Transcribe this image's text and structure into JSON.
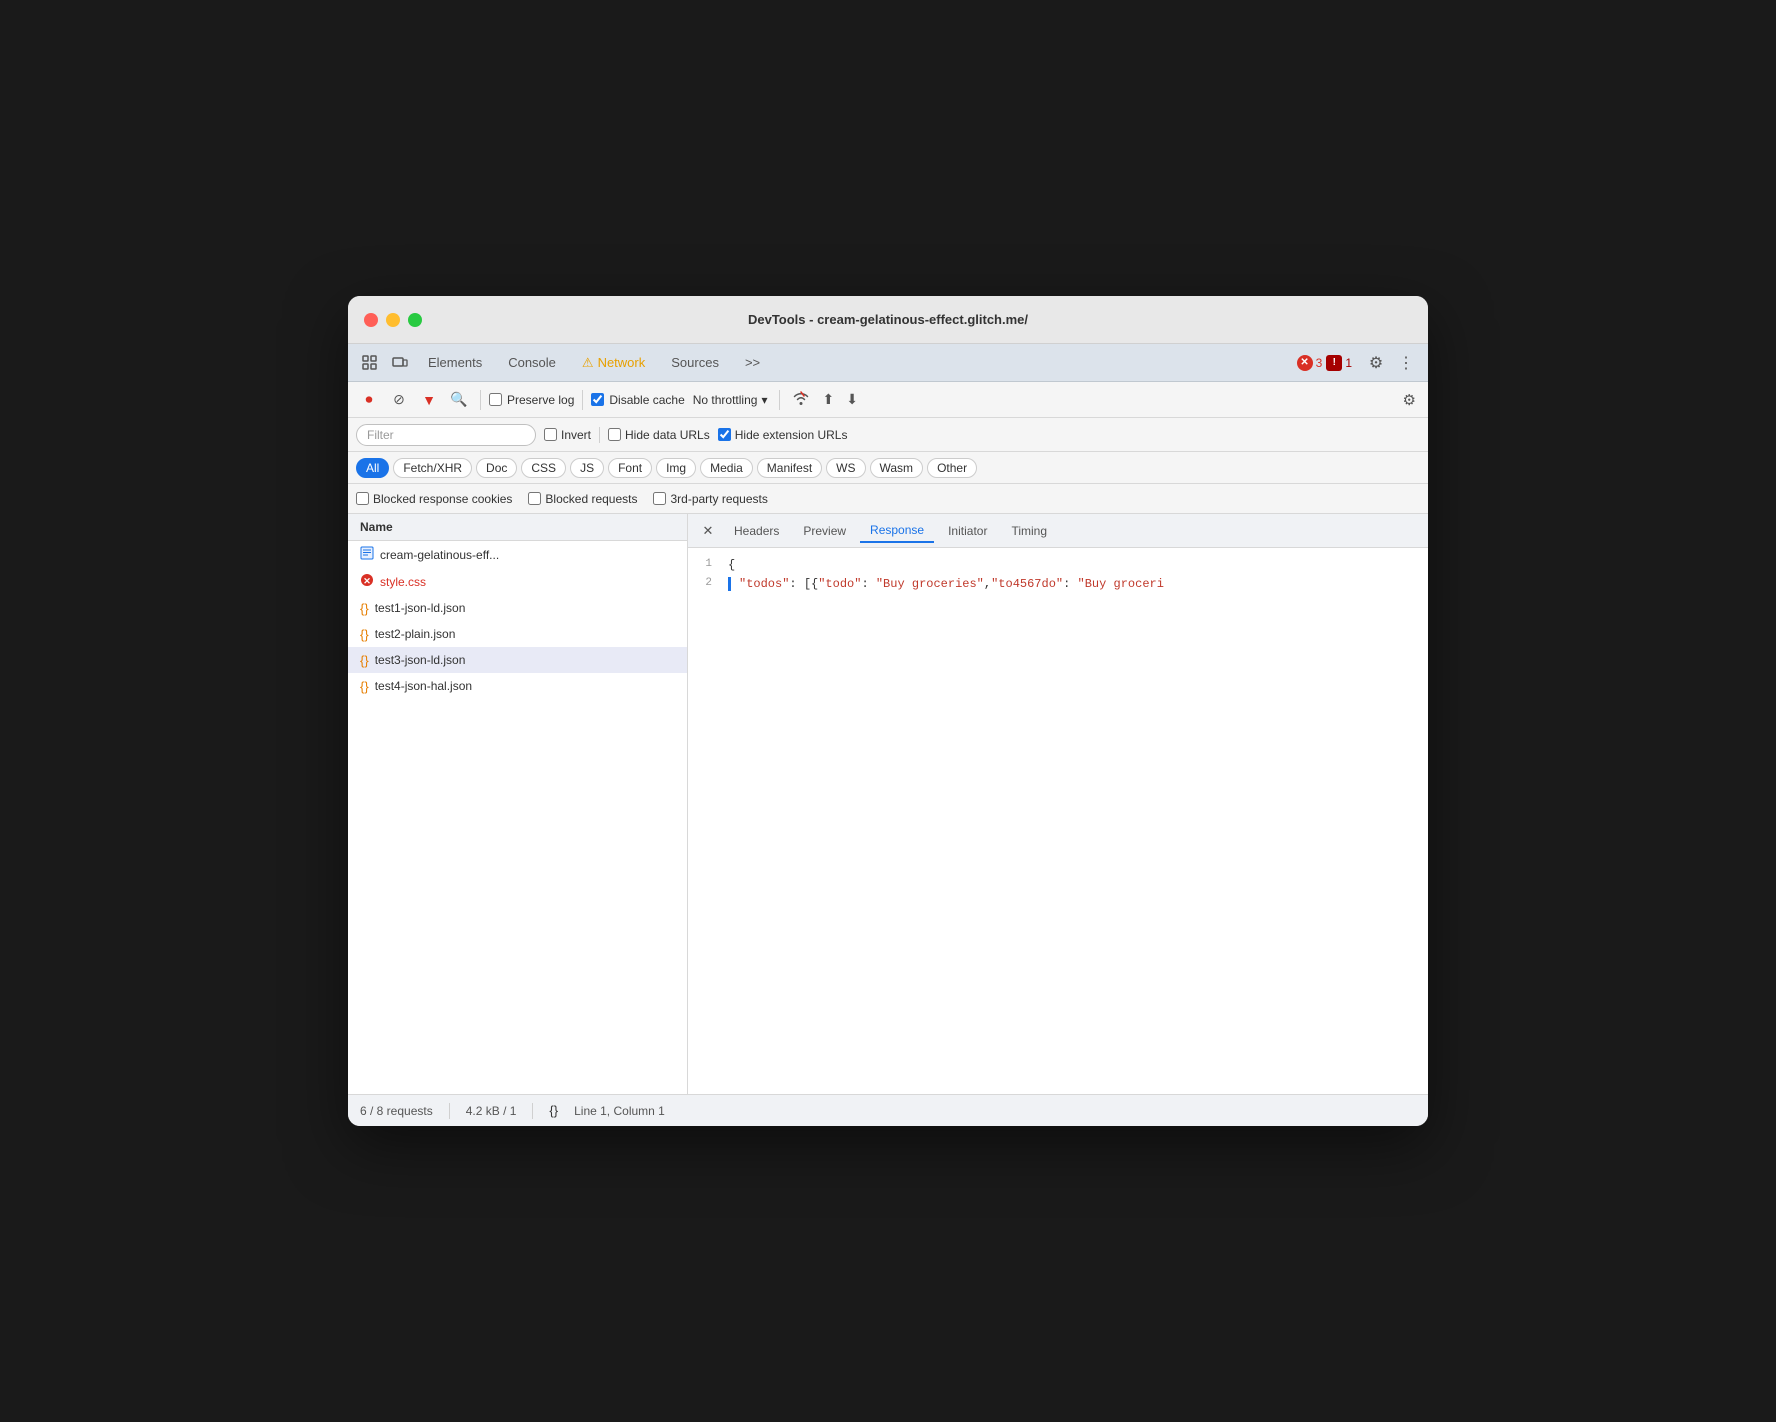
{
  "window": {
    "title": "DevTools - cream-gelatinous-effect.glitch.me/"
  },
  "tabs": {
    "items": [
      {
        "label": "Elements",
        "active": false
      },
      {
        "label": "Console",
        "active": false
      },
      {
        "label": "Network",
        "active": true,
        "warning": true
      },
      {
        "label": "Sources",
        "active": false
      }
    ],
    "more_label": ">>",
    "error_count": "3",
    "warning_count": "1"
  },
  "toolbar": {
    "preserve_log_label": "Preserve log",
    "disable_cache_label": "Disable cache",
    "throttling_label": "No throttling"
  },
  "filter": {
    "placeholder": "Filter",
    "invert_label": "Invert",
    "hide_data_label": "Hide data URLs",
    "hide_ext_label": "Hide extension URLs"
  },
  "type_filters": {
    "items": [
      {
        "label": "All",
        "active": true
      },
      {
        "label": "Fetch/XHR",
        "active": false
      },
      {
        "label": "Doc",
        "active": false
      },
      {
        "label": "CSS",
        "active": false
      },
      {
        "label": "JS",
        "active": false
      },
      {
        "label": "Font",
        "active": false
      },
      {
        "label": "Img",
        "active": false
      },
      {
        "label": "Media",
        "active": false
      },
      {
        "label": "Manifest",
        "active": false
      },
      {
        "label": "WS",
        "active": false
      },
      {
        "label": "Wasm",
        "active": false
      },
      {
        "label": "Other",
        "active": false
      }
    ]
  },
  "blocked": {
    "blocked_cookies_label": "Blocked response cookies",
    "blocked_requests_label": "Blocked requests",
    "third_party_label": "3rd-party requests"
  },
  "file_list": {
    "header": "Name",
    "items": [
      {
        "name": "cream-gelatinous-eff...",
        "type": "doc",
        "selected": false
      },
      {
        "name": "style.css",
        "type": "error",
        "selected": false
      },
      {
        "name": "test1-json-ld.json",
        "type": "json",
        "selected": false
      },
      {
        "name": "test2-plain.json",
        "type": "json",
        "selected": false
      },
      {
        "name": "test3-json-ld.json",
        "type": "json",
        "selected": true
      },
      {
        "name": "test4-json-hal.json",
        "type": "json",
        "selected": false
      }
    ]
  },
  "response_tabs": {
    "items": [
      {
        "label": "Headers",
        "active": false
      },
      {
        "label": "Preview",
        "active": false
      },
      {
        "label": "Response",
        "active": true
      },
      {
        "label": "Initiator",
        "active": false
      },
      {
        "label": "Timing",
        "active": false
      }
    ]
  },
  "response_content": {
    "line1": "{",
    "line2_key": "\"todos\"",
    "line2_colon": ":",
    "line2_value": " [{\"todo\": \"Buy groceries\",\"to4567do\": \"Buy groceri"
  },
  "status_bar": {
    "requests": "6 / 8 requests",
    "size": "4.2 kB / 1",
    "position": "Line 1, Column 1"
  }
}
